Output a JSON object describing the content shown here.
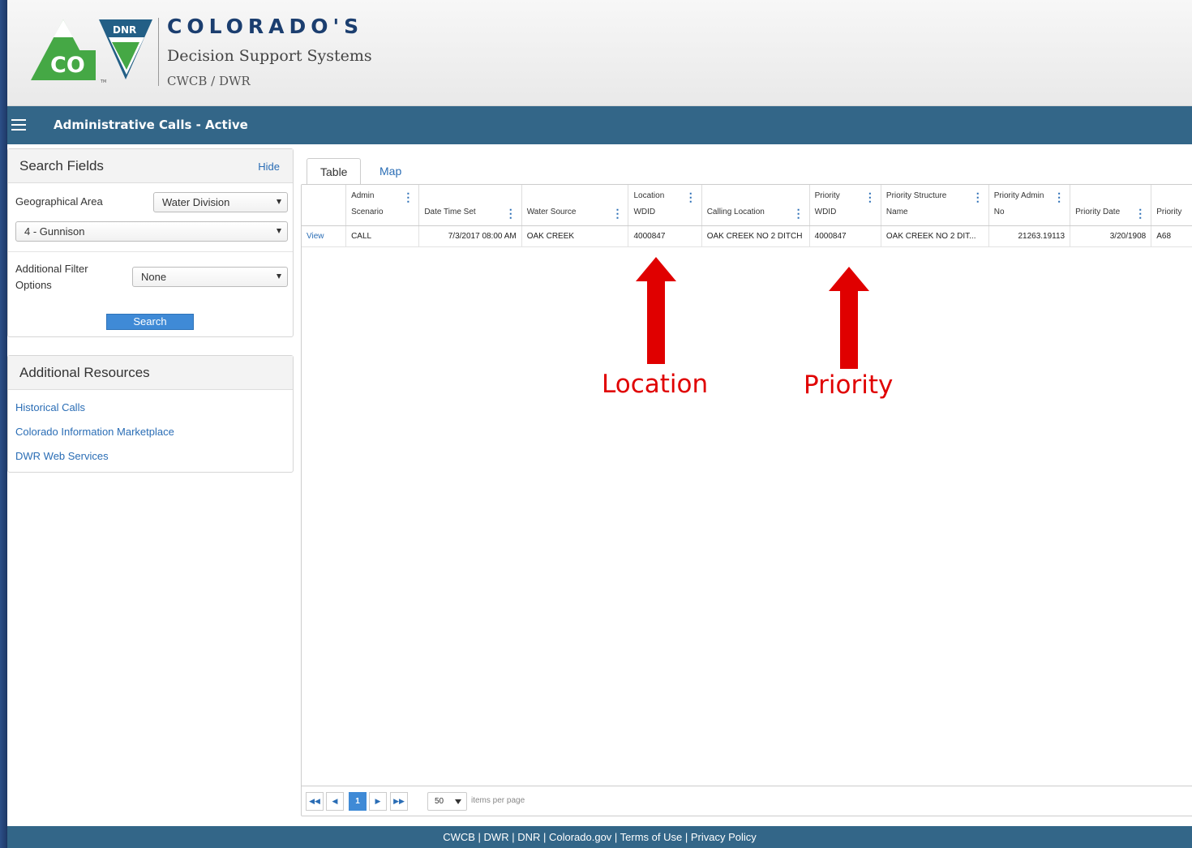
{
  "brand": {
    "logo_text_top": "DNR",
    "logo_text_main": "CO",
    "logo_tm": "TM",
    "title": "COLORADO'S",
    "subtitle": "Decision Support Systems",
    "org": "CWCB / DWR"
  },
  "navbar": {
    "title": "Administrative Calls - Active"
  },
  "search_panel": {
    "title": "Search Fields",
    "hide_label": "Hide",
    "geo_label": "Geographical Area",
    "geo_type": "Water Division",
    "geo_value": "4 - Gunnison",
    "filter_label_line1": "Additional Filter",
    "filter_label_line2": "Options",
    "filter_value": "None",
    "search_button": "Search"
  },
  "resources_panel": {
    "title": "Additional Resources",
    "links": [
      "Historical Calls",
      "Colorado Information Marketplace",
      "DWR Web Services"
    ]
  },
  "tabs": [
    "Table",
    "Map"
  ],
  "grid": {
    "headers": [
      [
        "",
        ""
      ],
      [
        "Admin",
        "Scenario"
      ],
      [
        "",
        "Date Time Set"
      ],
      [
        "",
        "Water Source"
      ],
      [
        "Location",
        "WDID"
      ],
      [
        "",
        "Calling Location"
      ],
      [
        "Priority",
        "WDID"
      ],
      [
        "Priority Structure",
        "Name"
      ],
      [
        "Priority Admin",
        "No"
      ],
      [
        "",
        "Priority Date"
      ],
      [
        "",
        "Priority"
      ]
    ],
    "rows": [
      [
        "View",
        "CALL",
        "7/3/2017 08:00 AM",
        "OAK CREEK",
        "4000847",
        "OAK CREEK NO 2 DITCH",
        "4000847",
        "OAK CREEK NO 2 DIT...",
        "21263.19113",
        "3/20/1908",
        "A68"
      ]
    ]
  },
  "pager": {
    "first": "◀◀",
    "prev": "◀",
    "current_page": "1",
    "next": "▶",
    "last": "▶▶",
    "page_size": "50",
    "page_size_label": "items per page"
  },
  "annotations": {
    "location_label": "Location",
    "priority_label": "Priority",
    "arrow_color": "#e00000"
  },
  "footer": {
    "links": [
      "CWCB",
      "DWR",
      "DNR",
      "Colorado.gov",
      "Terms of Use",
      "Privacy Policy"
    ],
    "separator": " | "
  }
}
